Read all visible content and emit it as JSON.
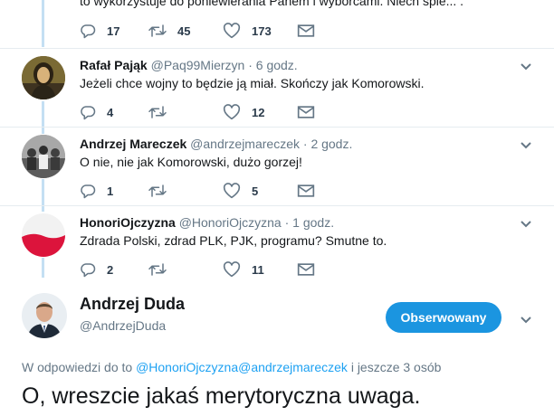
{
  "top_tweet": {
    "text": "to wykorzystuje do poniewierania Panem i wyborcami. Niech spie... .",
    "replies": "17",
    "retweets": "45",
    "likes": "173"
  },
  "replies": [
    {
      "name": "Rafał Pająk",
      "handle": "@Paq99Mierzyn",
      "dot": "·",
      "time": "6 godz.",
      "text": "Jeżeli chce wojny to będzie ją miał. Skończy jak Komorowski.",
      "replies": "4",
      "retweets": "",
      "likes": "12"
    },
    {
      "name": "Andrzej Mareczek",
      "handle": "@andrzejmareczek",
      "dot": "·",
      "time": "2 godz.",
      "text": "O nie, nie jak Komorowski, dużo gorzej!",
      "replies": "1",
      "retweets": "",
      "likes": "5"
    },
    {
      "name": "HonoriOjczyzna",
      "handle": "@HonoriOjczyzna",
      "dot": "·",
      "time": "1 godz.",
      "text": "Zdrada Polski, zdrad PLK, PJK, programu? Smutne to.",
      "replies": "2",
      "retweets": "",
      "likes": "11"
    }
  ],
  "main_tweet": {
    "name": "Andrzej Duda",
    "handle": "@AndrzejDuda",
    "follow_label": "Obserwowany",
    "reply_prefix": "W odpowiedzi do to",
    "reply_to_1": "@HonoriOjczyzna",
    "reply_to_2": "@andrzejmareczek",
    "reply_suffix": "i jeszcze 3 osób",
    "text": "O, wreszcie jakaś merytoryczna uwaga."
  },
  "colors": {
    "accent": "#1da1f2",
    "thread_line": "#c4dff3",
    "muted": "#657786",
    "follow_button": "#1b95e0",
    "flag_red": "#dc143c"
  },
  "icons": [
    "reply-icon",
    "retweet-icon",
    "like-icon",
    "dm-icon",
    "chevron-down-icon"
  ]
}
